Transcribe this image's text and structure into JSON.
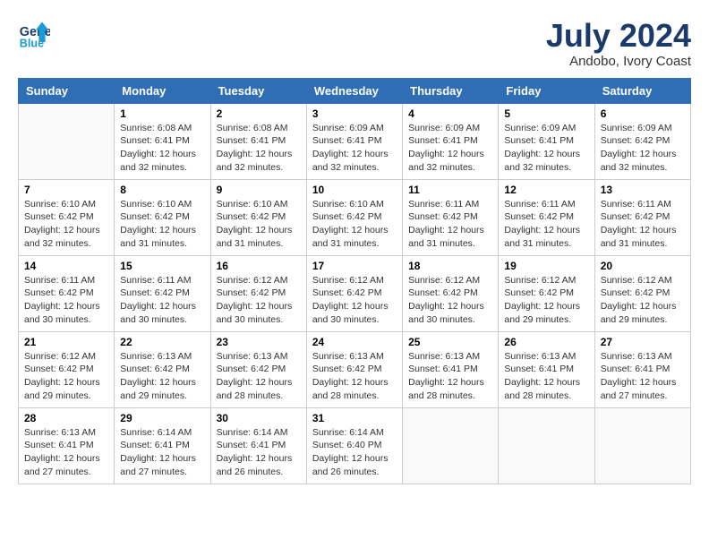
{
  "header": {
    "logo_line1": "General",
    "logo_line2": "Blue",
    "month_title": "July 2024",
    "location": "Andobo, Ivory Coast"
  },
  "days_of_week": [
    "Sunday",
    "Monday",
    "Tuesday",
    "Wednesday",
    "Thursday",
    "Friday",
    "Saturday"
  ],
  "weeks": [
    [
      {
        "day": "",
        "info": ""
      },
      {
        "day": "1",
        "info": "Sunrise: 6:08 AM\nSunset: 6:41 PM\nDaylight: 12 hours\nand 32 minutes."
      },
      {
        "day": "2",
        "info": "Sunrise: 6:08 AM\nSunset: 6:41 PM\nDaylight: 12 hours\nand 32 minutes."
      },
      {
        "day": "3",
        "info": "Sunrise: 6:09 AM\nSunset: 6:41 PM\nDaylight: 12 hours\nand 32 minutes."
      },
      {
        "day": "4",
        "info": "Sunrise: 6:09 AM\nSunset: 6:41 PM\nDaylight: 12 hours\nand 32 minutes."
      },
      {
        "day": "5",
        "info": "Sunrise: 6:09 AM\nSunset: 6:41 PM\nDaylight: 12 hours\nand 32 minutes."
      },
      {
        "day": "6",
        "info": "Sunrise: 6:09 AM\nSunset: 6:42 PM\nDaylight: 12 hours\nand 32 minutes."
      }
    ],
    [
      {
        "day": "7",
        "info": "Sunrise: 6:10 AM\nSunset: 6:42 PM\nDaylight: 12 hours\nand 32 minutes."
      },
      {
        "day": "8",
        "info": "Sunrise: 6:10 AM\nSunset: 6:42 PM\nDaylight: 12 hours\nand 31 minutes."
      },
      {
        "day": "9",
        "info": "Sunrise: 6:10 AM\nSunset: 6:42 PM\nDaylight: 12 hours\nand 31 minutes."
      },
      {
        "day": "10",
        "info": "Sunrise: 6:10 AM\nSunset: 6:42 PM\nDaylight: 12 hours\nand 31 minutes."
      },
      {
        "day": "11",
        "info": "Sunrise: 6:11 AM\nSunset: 6:42 PM\nDaylight: 12 hours\nand 31 minutes."
      },
      {
        "day": "12",
        "info": "Sunrise: 6:11 AM\nSunset: 6:42 PM\nDaylight: 12 hours\nand 31 minutes."
      },
      {
        "day": "13",
        "info": "Sunrise: 6:11 AM\nSunset: 6:42 PM\nDaylight: 12 hours\nand 31 minutes."
      }
    ],
    [
      {
        "day": "14",
        "info": "Sunrise: 6:11 AM\nSunset: 6:42 PM\nDaylight: 12 hours\nand 30 minutes."
      },
      {
        "day": "15",
        "info": "Sunrise: 6:11 AM\nSunset: 6:42 PM\nDaylight: 12 hours\nand 30 minutes."
      },
      {
        "day": "16",
        "info": "Sunrise: 6:12 AM\nSunset: 6:42 PM\nDaylight: 12 hours\nand 30 minutes."
      },
      {
        "day": "17",
        "info": "Sunrise: 6:12 AM\nSunset: 6:42 PM\nDaylight: 12 hours\nand 30 minutes."
      },
      {
        "day": "18",
        "info": "Sunrise: 6:12 AM\nSunset: 6:42 PM\nDaylight: 12 hours\nand 30 minutes."
      },
      {
        "day": "19",
        "info": "Sunrise: 6:12 AM\nSunset: 6:42 PM\nDaylight: 12 hours\nand 29 minutes."
      },
      {
        "day": "20",
        "info": "Sunrise: 6:12 AM\nSunset: 6:42 PM\nDaylight: 12 hours\nand 29 minutes."
      }
    ],
    [
      {
        "day": "21",
        "info": "Sunrise: 6:12 AM\nSunset: 6:42 PM\nDaylight: 12 hours\nand 29 minutes."
      },
      {
        "day": "22",
        "info": "Sunrise: 6:13 AM\nSunset: 6:42 PM\nDaylight: 12 hours\nand 29 minutes."
      },
      {
        "day": "23",
        "info": "Sunrise: 6:13 AM\nSunset: 6:42 PM\nDaylight: 12 hours\nand 28 minutes."
      },
      {
        "day": "24",
        "info": "Sunrise: 6:13 AM\nSunset: 6:42 PM\nDaylight: 12 hours\nand 28 minutes."
      },
      {
        "day": "25",
        "info": "Sunrise: 6:13 AM\nSunset: 6:41 PM\nDaylight: 12 hours\nand 28 minutes."
      },
      {
        "day": "26",
        "info": "Sunrise: 6:13 AM\nSunset: 6:41 PM\nDaylight: 12 hours\nand 28 minutes."
      },
      {
        "day": "27",
        "info": "Sunrise: 6:13 AM\nSunset: 6:41 PM\nDaylight: 12 hours\nand 27 minutes."
      }
    ],
    [
      {
        "day": "28",
        "info": "Sunrise: 6:13 AM\nSunset: 6:41 PM\nDaylight: 12 hours\nand 27 minutes."
      },
      {
        "day": "29",
        "info": "Sunrise: 6:14 AM\nSunset: 6:41 PM\nDaylight: 12 hours\nand 27 minutes."
      },
      {
        "day": "30",
        "info": "Sunrise: 6:14 AM\nSunset: 6:41 PM\nDaylight: 12 hours\nand 26 minutes."
      },
      {
        "day": "31",
        "info": "Sunrise: 6:14 AM\nSunset: 6:40 PM\nDaylight: 12 hours\nand 26 minutes."
      },
      {
        "day": "",
        "info": ""
      },
      {
        "day": "",
        "info": ""
      },
      {
        "day": "",
        "info": ""
      }
    ]
  ]
}
